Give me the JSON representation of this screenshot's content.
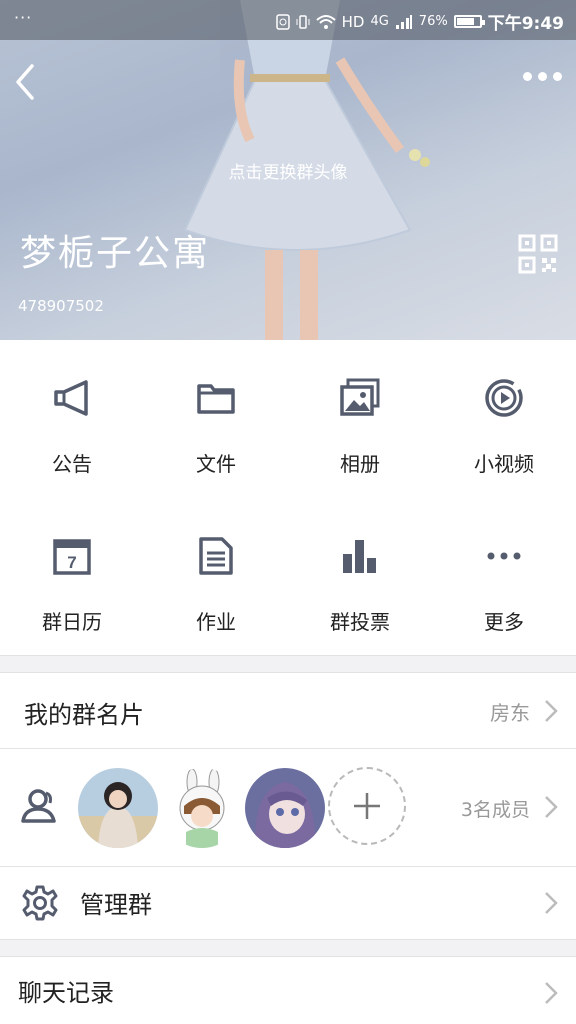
{
  "status": {
    "dots": "···",
    "hd": "HD",
    "net": "4G",
    "battery": "76%",
    "time": "下午9:49"
  },
  "header": {
    "change_avatar": "点击更换群头像",
    "group_name": "梦栀子公寓",
    "group_id": "478907502"
  },
  "features": [
    {
      "label": "公告",
      "icon": "megaphone-icon"
    },
    {
      "label": "文件",
      "icon": "folder-icon"
    },
    {
      "label": "相册",
      "icon": "album-icon"
    },
    {
      "label": "小视频",
      "icon": "video-icon"
    },
    {
      "label": "群日历",
      "icon": "calendar-icon"
    },
    {
      "label": "作业",
      "icon": "document-icon"
    },
    {
      "label": "群投票",
      "icon": "bar-chart-icon"
    },
    {
      "label": "更多",
      "icon": "more-icon"
    }
  ],
  "calendar_day": "7",
  "my_card": {
    "title": "我的群名片",
    "value": "房东"
  },
  "members": {
    "count": "3名成员"
  },
  "manage": {
    "title": "管理群"
  },
  "chat_history": {
    "title": "聊天记录"
  },
  "colors": {
    "icon": "#555c6e",
    "chevron": "#bbbbbb",
    "separator": "#f2f2f4"
  }
}
